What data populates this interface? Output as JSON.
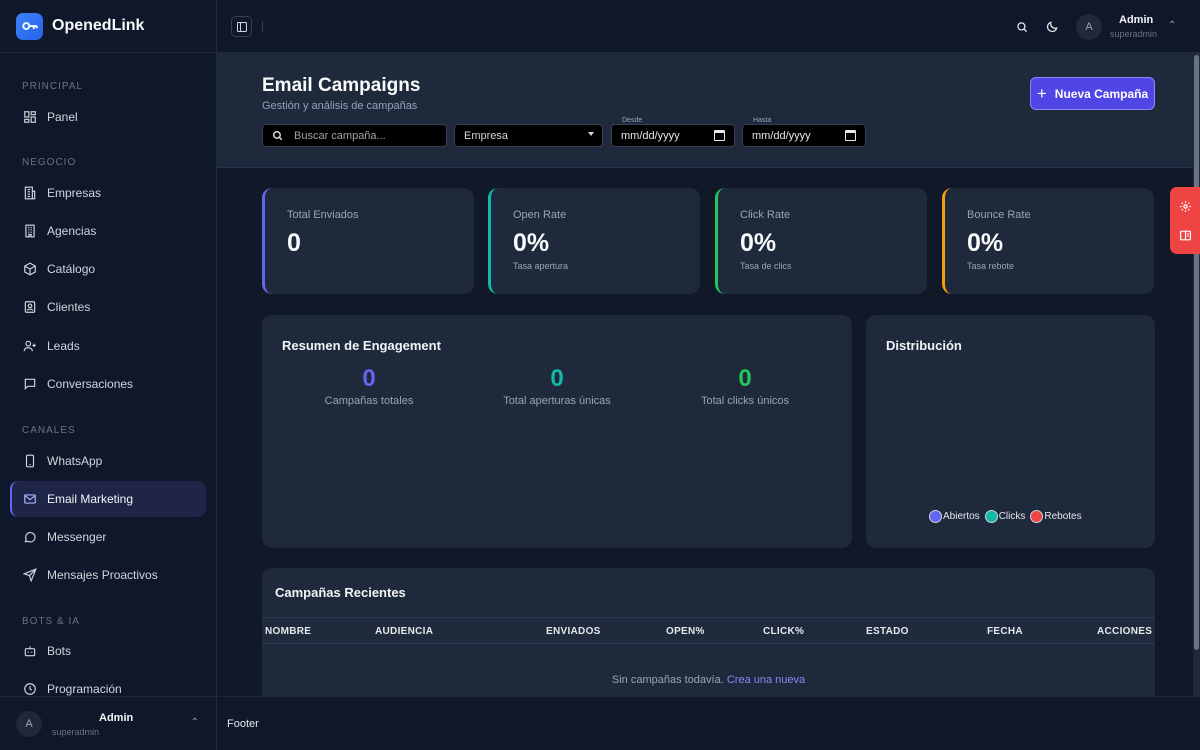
{
  "brand": {
    "name": "OpenedLink"
  },
  "sidebar": {
    "sections": [
      {
        "label": "PRINCIPAL",
        "items": [
          {
            "label": "Panel",
            "icon": "grid-icon"
          }
        ]
      },
      {
        "label": "NEGOCIO",
        "items": [
          {
            "label": "Empresas",
            "icon": "building-icon"
          },
          {
            "label": "Agencias",
            "icon": "office-icon"
          },
          {
            "label": "Catálogo",
            "icon": "box-icon"
          },
          {
            "label": "Clientes",
            "icon": "contact-icon"
          },
          {
            "label": "Leads",
            "icon": "user-plus-icon"
          },
          {
            "label": "Conversaciones",
            "icon": "chat-icon"
          }
        ]
      },
      {
        "label": "CANALES",
        "items": [
          {
            "label": "WhatsApp",
            "icon": "phone-icon"
          },
          {
            "label": "Email Marketing",
            "icon": "mail-icon",
            "active": true
          },
          {
            "label": "Messenger",
            "icon": "message-circle-icon"
          },
          {
            "label": "Mensajes Proactivos",
            "icon": "send-icon"
          }
        ]
      },
      {
        "label": "BOTS & IA",
        "items": [
          {
            "label": "Bots",
            "icon": "bot-icon"
          },
          {
            "label": "Programación",
            "icon": "clock-icon"
          }
        ]
      }
    ],
    "user": {
      "initial": "A",
      "name": "Admin",
      "role": "superadmin"
    }
  },
  "topbar": {
    "user": {
      "initial": "A",
      "name": "Admin",
      "role": "superadmin"
    }
  },
  "header": {
    "title": "Email Campaigns",
    "subtitle": "Gestión y análisis de campañas",
    "new_button": "Nueva Campaña",
    "search_placeholder": "Buscar campaña...",
    "company_select": "Empresa",
    "date_from_label": "Desde",
    "date_to_label": "Hasta",
    "date_placeholder": "mm/dd/yyyy"
  },
  "stats": [
    {
      "label": "Total Enviados",
      "value": "0",
      "sub": "",
      "color": "#6366f1"
    },
    {
      "label": "Open Rate",
      "value": "0%",
      "sub": "Tasa apertura",
      "color": "#14b8a6"
    },
    {
      "label": "Click Rate",
      "value": "0%",
      "sub": "Tasa de clics",
      "color": "#22c55e"
    },
    {
      "label": "Bounce Rate",
      "value": "0%",
      "sub": "Tasa rebote",
      "color": "#f59e0b"
    }
  ],
  "engagement": {
    "title": "Resumen de Engagement",
    "metrics": [
      {
        "value": "0",
        "label": "Campañas totales",
        "color": "#6366f1"
      },
      {
        "value": "0",
        "label": "Total aperturas únicas",
        "color": "#14b8a6"
      },
      {
        "value": "0",
        "label": "Total clicks únicos",
        "color": "#22c55e"
      }
    ]
  },
  "distribution": {
    "title": "Distribución",
    "legend": [
      {
        "label": "Abiertos",
        "color": "#6366f1"
      },
      {
        "label": "Clicks",
        "color": "#14b8a6"
      },
      {
        "label": "Rebotes",
        "color": "#ef4444"
      }
    ]
  },
  "recent": {
    "title": "Campañas Recientes",
    "columns": [
      "NOMBRE",
      "AUDIENCIA",
      "ENVIADOS",
      "OPEN%",
      "CLICK%",
      "ESTADO",
      "FECHA",
      "ACCIONES"
    ],
    "empty_text": "Sin campañas todavía.",
    "empty_link": "Crea una nueva"
  },
  "footer": {
    "text": "Footer"
  }
}
